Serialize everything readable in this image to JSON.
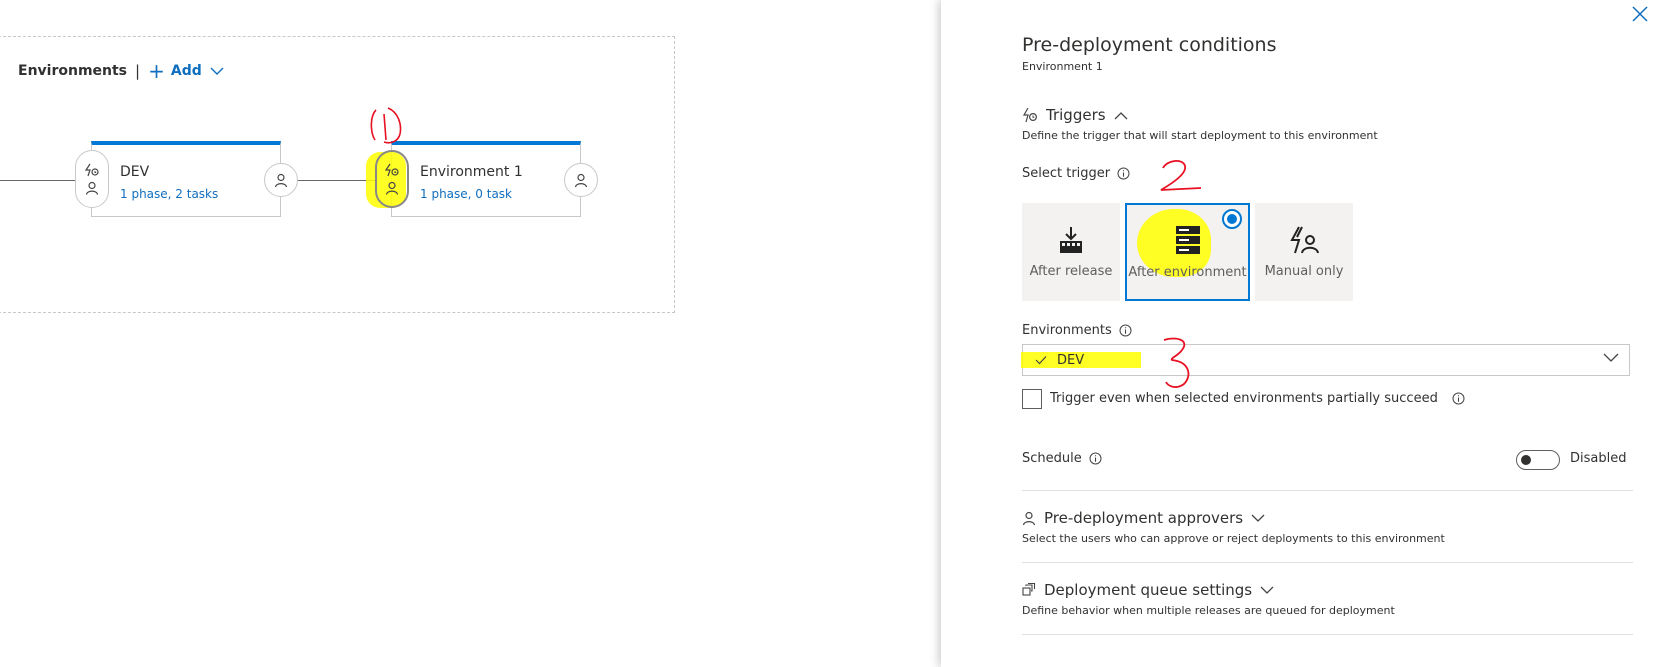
{
  "canvas": {
    "environments_title": "Environments",
    "separator": "|",
    "add_label": "Add",
    "stages": [
      {
        "name": "DEV",
        "summary": "1 phase, 2 tasks"
      },
      {
        "name": "Environment 1",
        "summary": "1 phase, 0 task"
      }
    ]
  },
  "panel": {
    "title": "Pre-deployment conditions",
    "subtitle": "Environment 1",
    "triggers": {
      "heading": "Triggers",
      "description": "Define the trigger that will start deployment to this environment",
      "select_label": "Select trigger",
      "options": [
        {
          "label": "After release",
          "icon": "release-icon",
          "selected": false
        },
        {
          "label": "After environment",
          "icon": "server-stack-icon",
          "selected": true
        },
        {
          "label": "Manual only",
          "icon": "manual-trigger-icon",
          "selected": false
        }
      ]
    },
    "environments": {
      "label": "Environments",
      "selected_value": "DEV",
      "partial_succeed_label": "Trigger even when selected environments partially succeed",
      "partial_succeed_checked": false
    },
    "schedule": {
      "label": "Schedule",
      "status": "Disabled",
      "enabled": false
    },
    "approvers": {
      "heading": "Pre-deployment approvers",
      "description": "Select the users who can approve or reject deployments to this environment"
    },
    "queue": {
      "heading": "Deployment queue settings",
      "description": "Define behavior when multiple releases are queued for deployment"
    }
  },
  "annotations": {
    "numbers": [
      "1",
      "2",
      "3"
    ],
    "highlight_color": "#ffff00",
    "pen_color": "#e81123"
  },
  "colors": {
    "accent": "#0078d4",
    "link": "#106ebe"
  }
}
